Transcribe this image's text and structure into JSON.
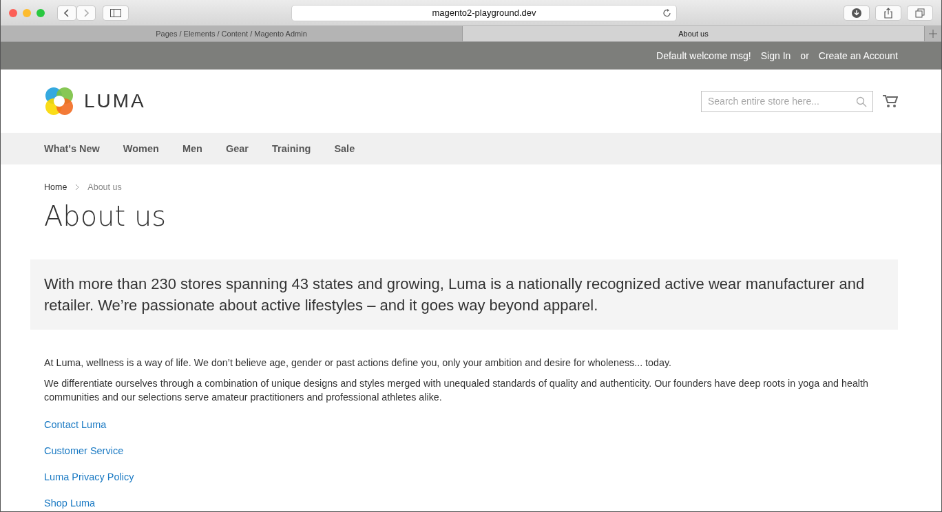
{
  "browser": {
    "address": "magento2-playground.dev",
    "tabs": [
      {
        "label": "Pages / Elements / Content / Magento Admin",
        "selected": false
      },
      {
        "label": "About us",
        "selected": true
      }
    ]
  },
  "top_bar": {
    "welcome": "Default welcome msg!",
    "sign_in": "Sign In",
    "or": "or",
    "create_account": "Create an Account"
  },
  "header": {
    "logo": "LUMA",
    "search": {
      "placeholder": "Search entire store here..."
    }
  },
  "nav": [
    "What's New",
    "Women",
    "Men",
    "Gear",
    "Training",
    "Sale"
  ],
  "breadcrumbs": [
    "Home",
    "About us"
  ],
  "title": "About us",
  "intro": "With more than 230 stores spanning 43 states and growing, Luma is a nationally recognized active wear manufacturer and retailer. We’re passionate about active lifestyles – and it goes way beyond apparel.",
  "paragraphs": [
    "At Luma, wellness is a way of life. We don’t believe age, gender or past actions define you, only your ambition and desire for wholeness... today.",
    "We differentiate ourselves through a combination of unique designs and styles merged with unequaled standards of quality and authenticity. Our founders have deep roots in yoga and health communities and our selections serve amateur practitioners and professional athletes alike."
  ],
  "links": [
    "Contact Luma",
    "Customer Service",
    "Luma Privacy Policy",
    "Shop Luma"
  ]
}
